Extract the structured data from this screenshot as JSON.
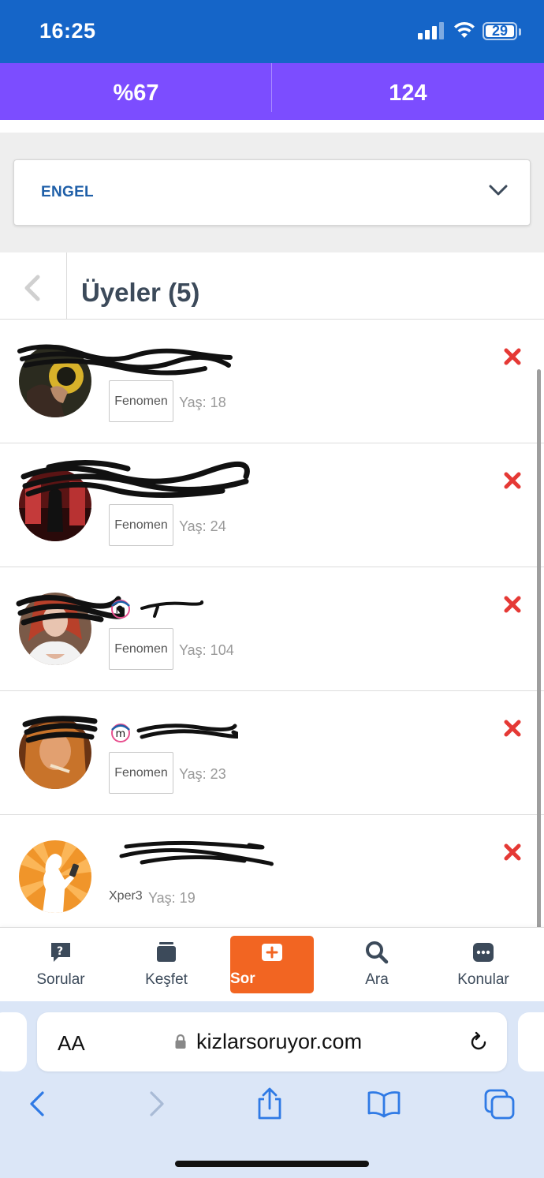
{
  "status_bar": {
    "time": "16:25",
    "battery": "29"
  },
  "stats": [
    {
      "value": "%67"
    },
    {
      "value": "124"
    }
  ],
  "filter": {
    "selected": "ENGEL"
  },
  "members": {
    "title": "Üyeler (5)",
    "items": [
      {
        "name": "",
        "badge": "Fenomen",
        "age": "Yaş: 18",
        "verified": false
      },
      {
        "name": "",
        "badge": "Fenomen",
        "age": "Yaş: 24",
        "verified": false
      },
      {
        "name": "",
        "badge": "Fenomen",
        "age": "Yaş: 104",
        "verified": true
      },
      {
        "name": "",
        "badge": "Fenomen",
        "age": "Yaş: 23",
        "verified": true
      },
      {
        "name": "",
        "level": "Xper3",
        "age": "Yaş: 19",
        "verified": false
      }
    ]
  },
  "bottom_nav": {
    "questions": "Sorular",
    "explore": "Keşfet",
    "ask": "Sor",
    "search": "Ara",
    "topics": "Konular"
  },
  "browser": {
    "aa_label": "AA",
    "url": "kizlarsoruyor.com"
  },
  "colors": {
    "status_bar": "#1565c8",
    "stats_band": "#7c4dff",
    "accent_name": "#e8508f",
    "remove": "#e53935",
    "ask_button": "#f26522"
  }
}
